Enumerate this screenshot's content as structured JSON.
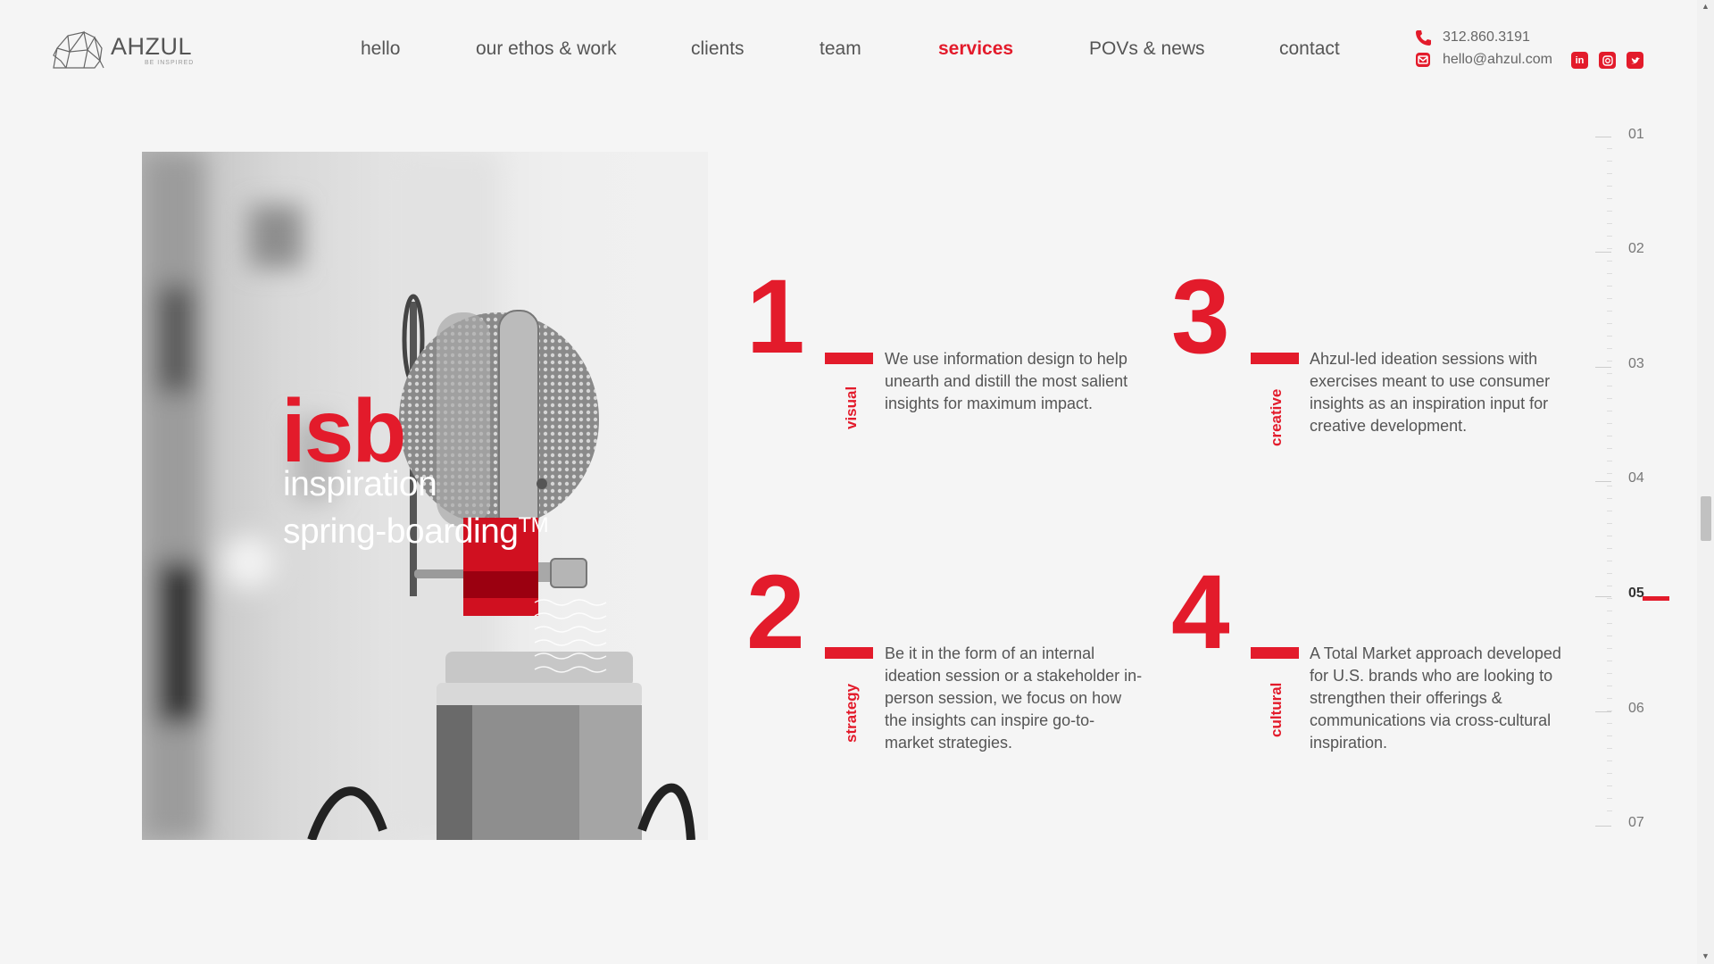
{
  "brand": {
    "name": "AHZUL",
    "tagline": "BE INSPIRED",
    "accent_color": "#e31b2b",
    "logo_icon": "elephant-logo-icon"
  },
  "nav": {
    "items": [
      {
        "label": "hello"
      },
      {
        "label": "our ethos & work"
      },
      {
        "label": "clients"
      },
      {
        "label": "team"
      },
      {
        "label": "services",
        "active": true
      },
      {
        "label": "POVs & news"
      },
      {
        "label": "contact"
      }
    ]
  },
  "contact": {
    "phone": "312.860.3191",
    "email": "hello@ahzul.com",
    "phone_icon": "phone-icon",
    "email_icon": "envelope-icon",
    "social": [
      "linkedin-icon",
      "instagram-icon",
      "twitter-icon"
    ]
  },
  "hero": {
    "title": "isb",
    "subtitle_line1": "inspiration",
    "subtitle_line2": "spring-boarding",
    "trademark": "TM",
    "image": "microphone-photo"
  },
  "services": [
    {
      "number": "1",
      "label": "visual",
      "text": "We use information design to help unearth and distill the most salient insights for maximum impact."
    },
    {
      "number": "2",
      "label": "strategy",
      "text": "Be it in the form of an internal ideation session or a stakeholder in-person session, we focus on how the insights can inspire go-to-market strategies."
    },
    {
      "number": "3",
      "label": "creative",
      "text": "Ahzul-led ideation sessions with exercises meant to use consumer insights as an inspiration input for creative development."
    },
    {
      "number": "4",
      "label": "cultural",
      "text": "A Total Market approach developed for U.S. brands who are looking to strengthen their offerings & communications via cross-cultural inspiration."
    }
  ],
  "section_indicator": {
    "items": [
      "01",
      "02",
      "03",
      "04",
      "05",
      "06",
      "07"
    ],
    "active": "05"
  }
}
